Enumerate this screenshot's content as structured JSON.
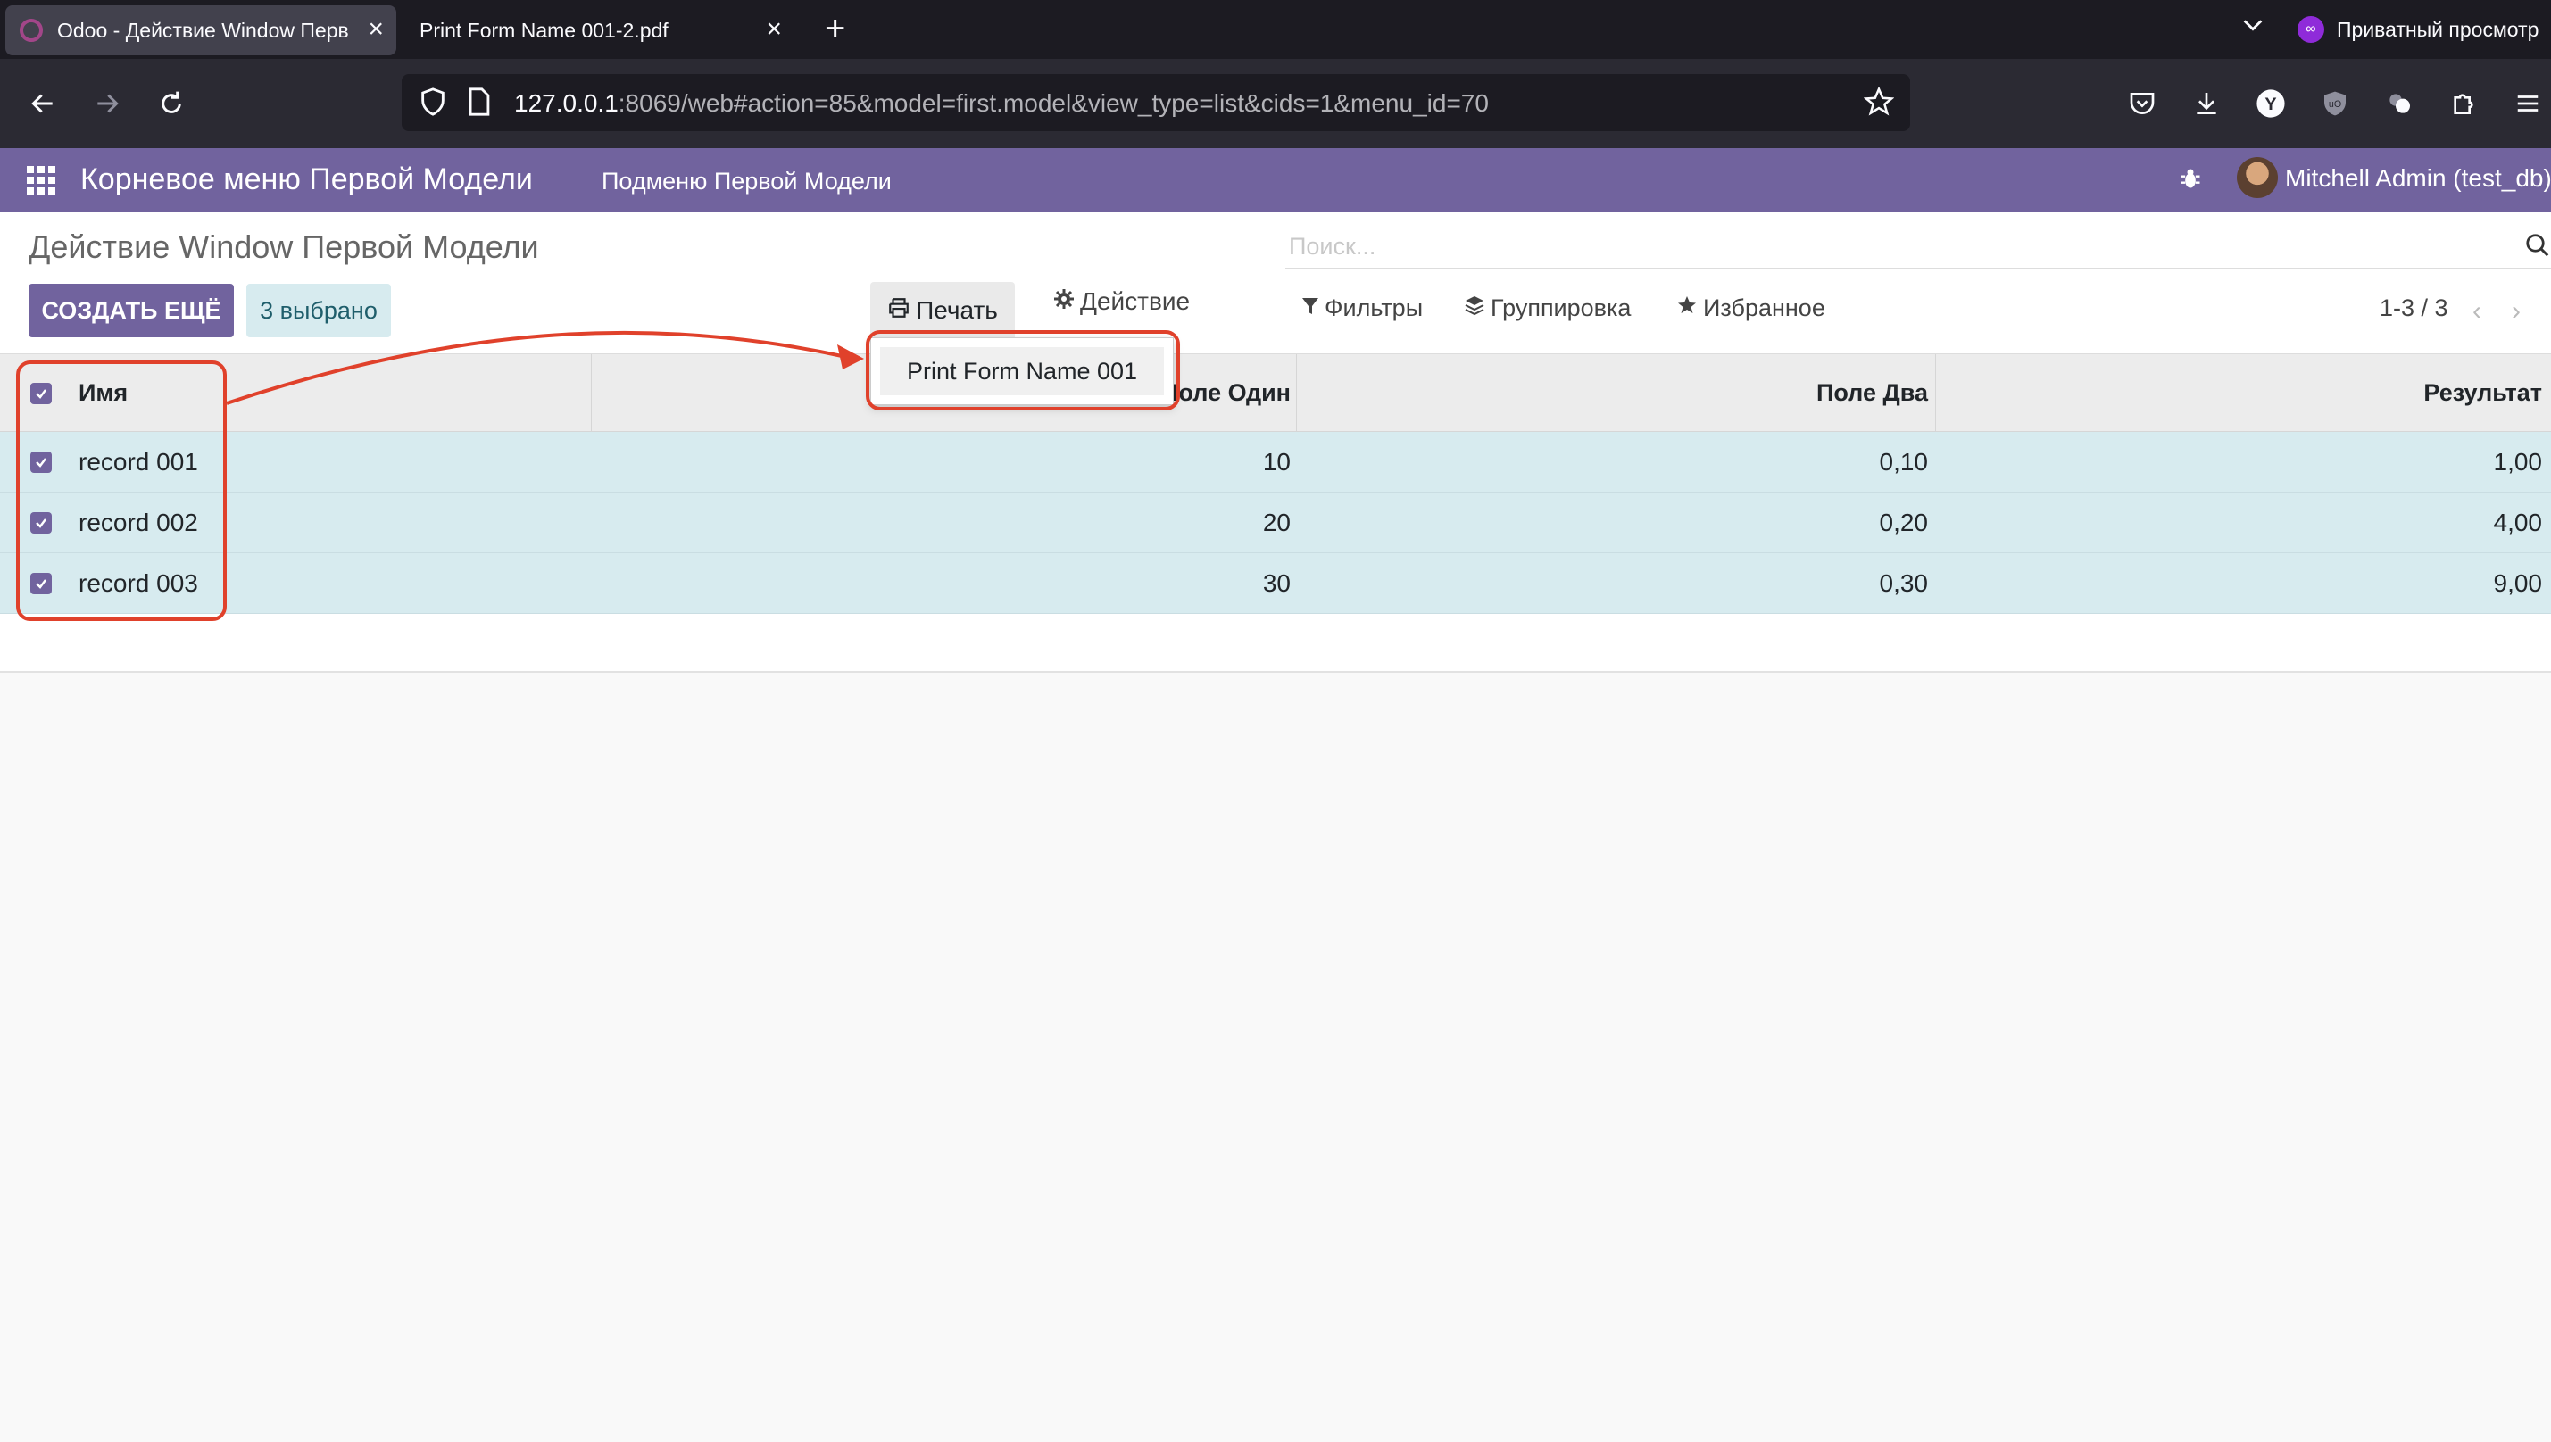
{
  "browser": {
    "tabs": [
      {
        "title": "Odoo - Действие Window Перв",
        "active": true
      },
      {
        "title": "Print Form Name 001-2.pdf",
        "active": false
      }
    ],
    "private_label": "Приватный просмотр",
    "url_host": "127.0.0.1",
    "url_rest": ":8069/web#action=85&model=first.model&view_type=list&cids=1&menu_id=70",
    "icons": [
      "back-icon",
      "forward-icon",
      "reload-icon",
      "shield-icon",
      "page-icon",
      "star-icon",
      "pocket-icon",
      "download-icon",
      "yandex-icon",
      "ublock-icon",
      "extension-icon",
      "puzzle-icon",
      "menu-icon"
    ]
  },
  "odoo_nav": {
    "brand": "Корневое меню Первой Модели",
    "submenu": "Подменю Первой Модели",
    "user": "Mitchell Admin (test_db)"
  },
  "control_panel": {
    "title": "Действие Window Первой Модели",
    "create_label": "СОЗДАТЬ ЕЩЁ",
    "selected_label": "3 выбрано",
    "print_label": "Печать",
    "action_label": "Действие",
    "search_placeholder": "Поиск...",
    "filters_label": "Фильтры",
    "groupby_label": "Группировка",
    "favorites_label": "Избранное",
    "pager": "1-3 / 3"
  },
  "print_menu": {
    "items": [
      "Print Form Name 001"
    ]
  },
  "table": {
    "headers": {
      "name": "Имя",
      "field1": "Поле Один",
      "field2": "Поле Два",
      "result": "Результат"
    },
    "rows": [
      {
        "name": "record 001",
        "field1": "10",
        "field2": "0,10",
        "result": "1,00",
        "checked": true
      },
      {
        "name": "record 002",
        "field1": "20",
        "field2": "0,20",
        "result": "4,00",
        "checked": true
      },
      {
        "name": "record 003",
        "field1": "30",
        "field2": "0,30",
        "result": "9,00",
        "checked": true
      }
    ]
  },
  "colors": {
    "odoo_purple": "#71639e",
    "selected_row": "#d7ebef",
    "annotation": "#e0412b"
  }
}
